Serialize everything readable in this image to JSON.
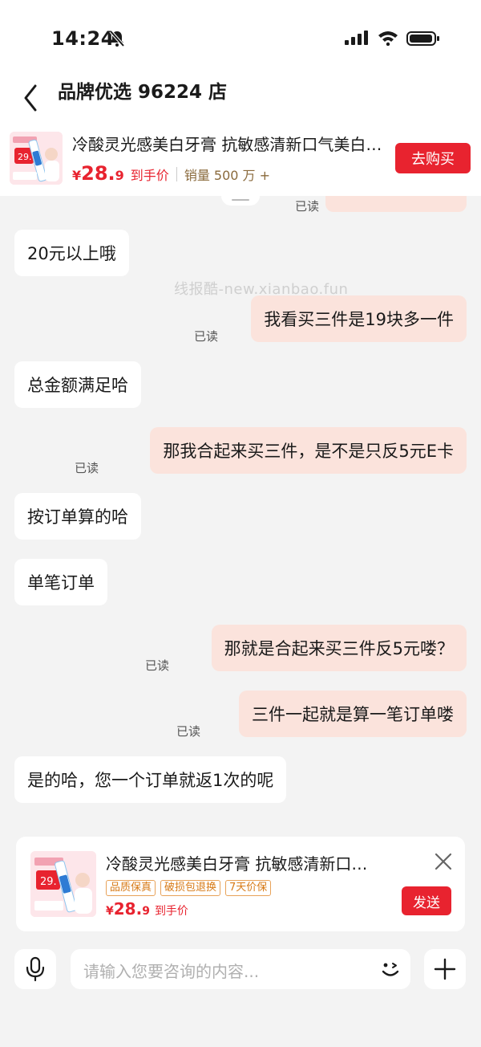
{
  "status_bar": {
    "time": "14:24"
  },
  "header": {
    "title": "品牌优选 96224 店"
  },
  "product": {
    "name": "冷酸灵光感美白牙膏 抗敏感清新口气美白牙膏",
    "price_symbol": "¥",
    "price_int": "28.",
    "price_dec": "9",
    "price_label": "到手价",
    "sales": "销量 500 万 +",
    "buy_label": "去购买",
    "thumb_text": "29."
  },
  "watermark": "线报酷-new.xianbao.fun",
  "messages": [
    {
      "side": "right",
      "text": "",
      "read": "已读"
    },
    {
      "side": "left",
      "text": "20元以上哦"
    },
    {
      "side": "right",
      "text": "我看买三件是19块多一件",
      "read": "已读"
    },
    {
      "side": "left",
      "text": "总金额满足哈"
    },
    {
      "side": "right",
      "text": "那我合起来买三件，是不是只反5元E卡",
      "read": "已读"
    },
    {
      "side": "left",
      "text": "按订单算的哈"
    },
    {
      "side": "left",
      "text": "单笔订单"
    },
    {
      "side": "right",
      "text": "那就是合起来买三件反5元喽？",
      "read": "已读"
    },
    {
      "side": "right",
      "text": "三件一起就是算一笔订单喽",
      "read": "已读"
    },
    {
      "side": "left",
      "text": "是的哈，您一个订单就返1次的呢"
    }
  ],
  "product_card": {
    "name": "冷酸灵光感美白牙膏 抗敏感清新口气美白牙膏",
    "tags": [
      "品质保真",
      "破损包退换",
      "7天价保"
    ],
    "price_symbol": "¥",
    "price_int": "28.",
    "price_dec": "9",
    "price_label": "到手价",
    "send_label": "发送",
    "thumb_text": "29."
  },
  "input": {
    "placeholder": "请输入您要咨询的内容..."
  },
  "colors": {
    "accent": "#e8232f",
    "bubble_mine": "#fbe3dc",
    "background": "#f3f3f3"
  }
}
